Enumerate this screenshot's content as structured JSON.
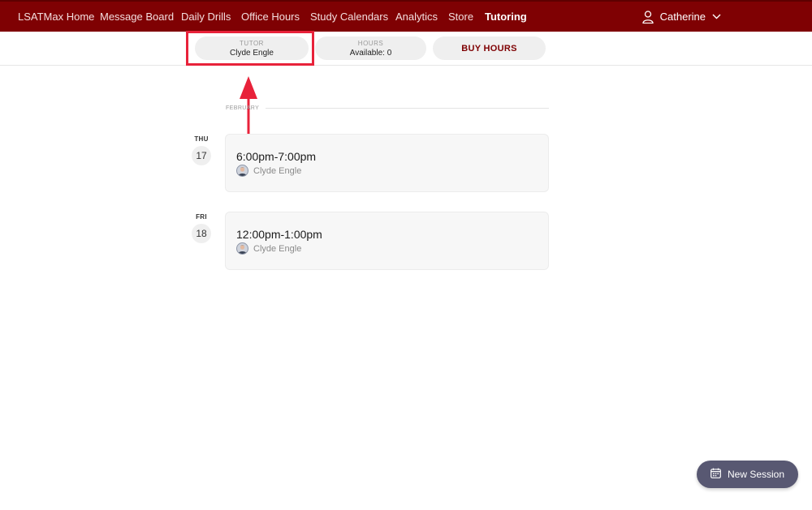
{
  "nav": {
    "items": [
      {
        "label": "LSATMax Home"
      },
      {
        "label": "Message Board"
      },
      {
        "label": "Daily Drills"
      },
      {
        "label": "Office Hours"
      },
      {
        "label": "Study Calendars"
      },
      {
        "label": "Analytics"
      },
      {
        "label": "Store"
      },
      {
        "label": "Tutoring"
      }
    ],
    "active": "Tutoring",
    "user_name": "Catherine"
  },
  "subbar": {
    "tutor_label": "TUTOR",
    "tutor_value": "Clyde Engle",
    "hours_label": "HOURS",
    "hours_value": "Available: 0",
    "buy_label": "BUY HOURS"
  },
  "schedule": {
    "month": "FEBRUARY",
    "days": [
      {
        "dow": "THU",
        "day": "17",
        "time": "6:00pm-7:00pm",
        "tutor": "Clyde Engle"
      },
      {
        "dow": "FRI",
        "day": "18",
        "time": "12:00pm-1:00pm",
        "tutor": "Clyde Engle"
      }
    ]
  },
  "new_session_label": "New Session",
  "colors": {
    "brand": "#7f0103",
    "highlight": "#e8223a",
    "button": "#585872"
  },
  "icons": {
    "user": "user-icon",
    "chevron": "chevron-down-icon",
    "calendar": "calendar-icon",
    "avatar": "avatar"
  }
}
